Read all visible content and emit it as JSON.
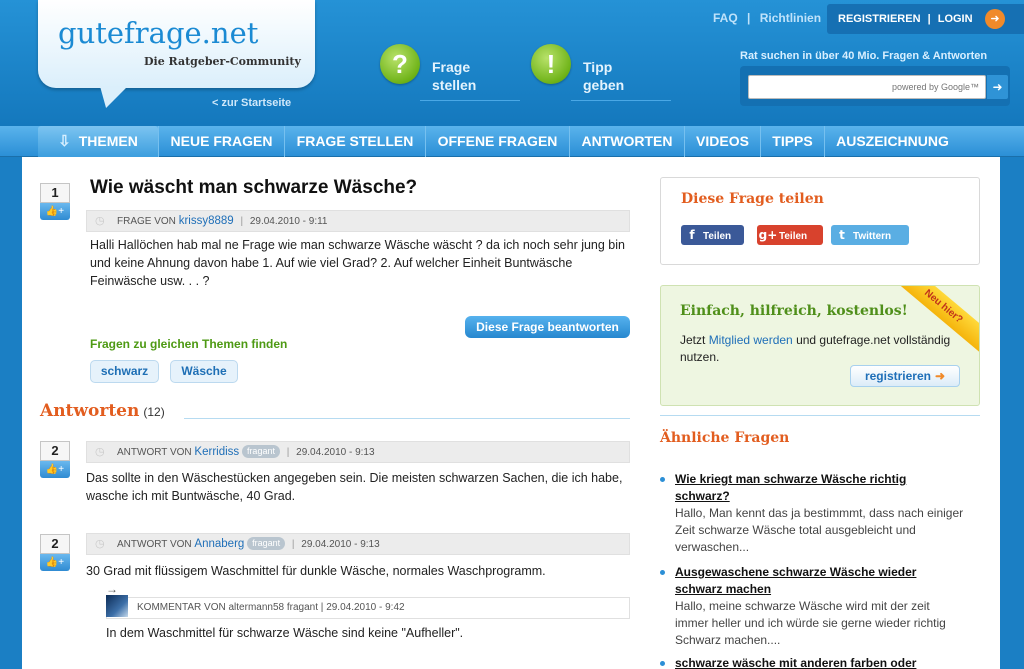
{
  "header": {
    "logo": "gutefrage.net",
    "tagline": "Die Ratgeber-Community",
    "back_link": "< zur Startseite",
    "ask_button": {
      "icon": "?",
      "line1": "Frage",
      "line2": "stellen"
    },
    "tip_button": {
      "icon": "!",
      "line1": "Tipp",
      "line2": "geben"
    },
    "faq": "FAQ",
    "guidelines": "Richtlinien",
    "register": "REGISTRIEREN",
    "separator": "|",
    "login": "LOGIN",
    "search_caption": "Rat suchen in über 40 Mio. Fragen & Antworten",
    "search_placeholder": "powered by Google™"
  },
  "nav": {
    "items": [
      "THEMEN",
      "NEUE FRAGEN",
      "FRAGE STELLEN",
      "OFFENE FRAGEN",
      "ANTWORTEN",
      "VIDEOS",
      "TIPPS",
      "AUSZEICHNUNG"
    ]
  },
  "question": {
    "votes": "1",
    "title": "Wie wäscht man schwarze Wäsche?",
    "meta_label": "FRAGE VON",
    "author": "krissy8889",
    "date": "29.04.2010 - 9:11",
    "body": "Halli Hallöchen hab mal ne Frage wie man schwarze Wäsche wäscht ? da ich noch sehr jung bin und keine Ahnung davon habe 1. Auf wie viel Grad? 2. Auf welcher Einheit Buntwäsche Feinwäsche usw. . . ?",
    "answer_button": "Diese Frage beantworten",
    "related_label": "Fragen zu gleichen Themen finden",
    "tags": [
      "schwarz",
      "Wäsche"
    ]
  },
  "answers": {
    "heading": "Antworten",
    "count": "(12)",
    "items": [
      {
        "votes": "2",
        "meta_label": "ANTWORT VON",
        "author": "Kerridiss",
        "badge": "fragant",
        "date": "29.04.2010 - 9:13",
        "text": "Das sollte in den Wäschestücken angegeben sein. Die meisten schwarzen Sachen, die ich habe, wasche ich mit Buntwäsche, 40 Grad."
      },
      {
        "votes": "2",
        "meta_label": "ANTWORT VON",
        "author": "Annaberg",
        "badge": "fragant",
        "date": "29.04.2010 - 9:13",
        "text": "30 Grad mit flüssigem Waschmittel für dunkle Wäsche, normales Waschprogramm."
      }
    ],
    "comment": {
      "arrow": "→",
      "meta_label": "KOMMENTAR VON",
      "author": "altermann58",
      "badge": "fragant",
      "date": "29.04.2010 - 9:42",
      "text": "In dem Waschmittel für schwarze Wäsche sind keine \"Aufheller\"."
    }
  },
  "sidebar": {
    "share_title": "Diese Frage teilen",
    "share_buttons": [
      {
        "icon": "f",
        "label": "Teilen"
      },
      {
        "icon": "g+",
        "label": "Teilen"
      },
      {
        "icon": "t",
        "label": "Twittern"
      }
    ],
    "promo": {
      "title": "Einfach, hilfreich, kostenlos!",
      "ribbon": "Neu hier?",
      "text_before": "Jetzt ",
      "link": "Mitglied werden",
      "text_after": " und gutefrage.net vollständig nutzen.",
      "button": "registrieren"
    },
    "similar_title": "Ähnliche Fragen",
    "similar": [
      {
        "q": "Wie kriegt man schwarze Wäsche richtig schwarz?",
        "d": "Hallo, Man kennt das ja bestimmmt, dass nach einiger Zeit schwarze Wäsche total ausgebleicht und verwaschen..."
      },
      {
        "q": "Ausgewaschene schwarze Wäsche wieder schwarz machen",
        "d": "Hallo, meine schwarze Wäsche wird mit der zeit immer heller und ich würde sie gerne wieder richtig Schwarz machen...."
      },
      {
        "q": "schwarze wäsche mit anderen farben oder",
        "d": ""
      }
    ]
  },
  "colors": {
    "brand_blue": "#1b7fc4",
    "accent_orange": "#e25d1f",
    "green": "#4f8f1a"
  }
}
